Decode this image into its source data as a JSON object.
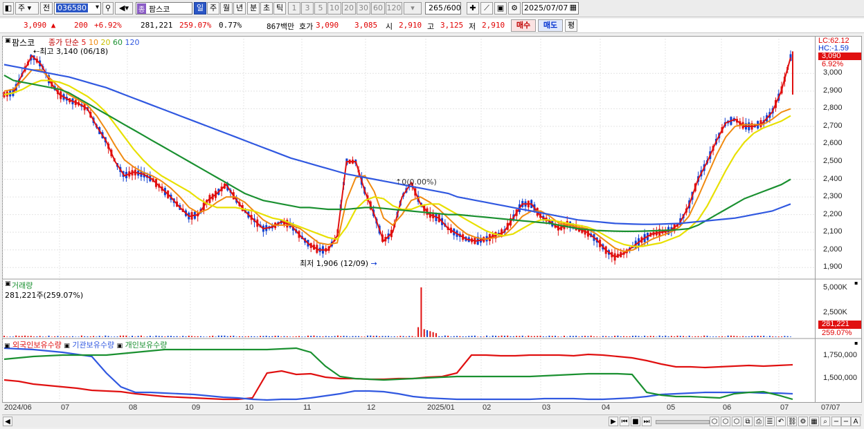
{
  "toolbar": {
    "market": "주",
    "prev_label": "전",
    "code": "036580",
    "stock_name": "팜스코",
    "stock_badge": "종",
    "periods": [
      "일",
      "주",
      "월",
      "년",
      "분",
      "초",
      "틱"
    ],
    "minutes": [
      "1",
      "3",
      "5",
      "10",
      "20",
      "30",
      "60",
      "120"
    ],
    "count": "265",
    "count_total": "/600",
    "date": "2025/07/07"
  },
  "info": {
    "price": "3,090 ▲",
    "change": "200",
    "change_pct": "+6.92%",
    "volume": "281,221",
    "volume_pct": "259.07%",
    "turnover": "0.77%",
    "amount": "867백만",
    "quote_label": "호가",
    "ask": "3,090",
    "bid": "3,085",
    "open_label": "시",
    "open": "2,910",
    "high_label": "고",
    "high": "3,125",
    "low_label": "저",
    "low": "2,910",
    "buy": "매수",
    "sell": "매도",
    "avg": "평"
  },
  "price_panel": {
    "name": "팜스코",
    "legend": "종가 단순 5 10 20 60 120",
    "ma_labels": [
      "5",
      "10",
      "20",
      "60",
      "120"
    ],
    "ma_colors": [
      "#e01010",
      "#f08a10",
      "#e8e000",
      "#1a9030",
      "#3058e0"
    ],
    "high_note": "최고 3,140 (06/18)",
    "low_note": "최저 1,906 (12/09)",
    "mid_note": "0(0.00%)",
    "lc": "LC:62.12",
    "hc": "HC:-1.59",
    "current_price": "3,090",
    "current_pct": "6.92%",
    "yticks": [
      "3,000",
      "2,900",
      "2,800",
      "2,700",
      "2,600",
      "2,500",
      "2,400",
      "2,300",
      "2,200",
      "2,100",
      "2,000",
      "1,900"
    ]
  },
  "volume_panel": {
    "title": "거래량",
    "value": "281,221주(259.07%)",
    "yticks": [
      "5,000K",
      "2,500K"
    ],
    "current": "281,221",
    "current_pct": "259.07%"
  },
  "holdings_panel": {
    "labels": [
      "외국인보유수량",
      "기관보유수량",
      "개인보유수량"
    ],
    "colors": [
      "#e01010",
      "#3058e0",
      "#1a9030"
    ],
    "yticks": [
      "1,750,000",
      "1,500,000"
    ]
  },
  "x_axis": [
    "2024/06",
    "07",
    "08",
    "09",
    "10",
    "11",
    "12",
    "2025/01",
    "02",
    "03",
    "04",
    "05",
    "06",
    "07"
  ],
  "x_right": "07/07",
  "chart_data": {
    "type": "candlestick",
    "period": "daily",
    "ylim": [
      1850,
      3150
    ],
    "series": [
      {
        "name": "5",
        "values": [
          2880,
          2890,
          3000,
          3100,
          3050,
          2950,
          2880,
          2850,
          2830,
          2800,
          2700,
          2620,
          2500,
          2420,
          2440,
          2430,
          2400,
          2350,
          2300,
          2240,
          2190,
          2200,
          2280,
          2320,
          2370,
          2290,
          2220,
          2170,
          2120,
          2130,
          2160,
          2140,
          2080,
          2030,
          2000,
          2000,
          2080,
          2500,
          2500,
          2330,
          2200,
          2050,
          2100,
          2300,
          2380,
          2260,
          2200,
          2180,
          2120,
          2090,
          2060,
          2050,
          2060,
          2080,
          2100,
          2180,
          2260,
          2260,
          2190,
          2160,
          2120,
          2150,
          2120,
          2100,
          2060,
          2000,
          1960,
          1980,
          2020,
          2060,
          2090,
          2100,
          2110,
          2150,
          2250,
          2400,
          2500,
          2620,
          2720,
          2740,
          2700,
          2700,
          2720,
          2780,
          2900,
          3090
        ]
      },
      {
        "name": "10",
        "values": [
          2900,
          2910,
          2960,
          3020,
          3020,
          2970,
          2920,
          2880,
          2850,
          2820,
          2760,
          2680,
          2590,
          2510,
          2470,
          2440,
          2420,
          2390,
          2350,
          2300,
          2240,
          2210,
          2230,
          2270,
          2300,
          2300,
          2270,
          2220,
          2170,
          2140,
          2140,
          2140,
          2120,
          2080,
          2040,
          2030,
          2040,
          2280,
          2410,
          2420,
          2330,
          2180,
          2140,
          2200,
          2280,
          2300,
          2270,
          2230,
          2180,
          2130,
          2090,
          2070,
          2060,
          2070,
          2080,
          2130,
          2190,
          2220,
          2220,
          2190,
          2150,
          2140,
          2130,
          2120,
          2090,
          2050,
          2010,
          1990,
          2000,
          2030,
          2060,
          2080,
          2100,
          2130,
          2190,
          2300,
          2420,
          2540,
          2640,
          2700,
          2710,
          2710,
          2710,
          2740,
          2780,
          2800
        ]
      },
      {
        "name": "20",
        "values": [
          2880,
          2890,
          2910,
          2940,
          2960,
          2960,
          2950,
          2930,
          2900,
          2870,
          2830,
          2780,
          2710,
          2640,
          2570,
          2510,
          2460,
          2420,
          2390,
          2360,
          2330,
          2290,
          2260,
          2240,
          2240,
          2240,
          2230,
          2220,
          2200,
          2180,
          2170,
          2150,
          2130,
          2110,
          2090,
          2070,
          2060,
          2130,
          2230,
          2280,
          2300,
          2290,
          2250,
          2230,
          2230,
          2250,
          2260,
          2260,
          2230,
          2200,
          2170,
          2140,
          2110,
          2090,
          2080,
          2090,
          2120,
          2150,
          2170,
          2170,
          2160,
          2150,
          2140,
          2130,
          2110,
          2080,
          2050,
          2030,
          2020,
          2020,
          2030,
          2040,
          2060,
          2080,
          2120,
          2170,
          2250,
          2350,
          2450,
          2540,
          2610,
          2660,
          2690,
          2710,
          2730,
          2760
        ]
      },
      {
        "name": "60",
        "values": [
          2990,
          2960,
          2950,
          2940,
          2930,
          2920,
          2910,
          2890,
          2860,
          2830,
          2800,
          2770,
          2740,
          2710,
          2680,
          2650,
          2620,
          2590,
          2560,
          2530,
          2500,
          2470,
          2440,
          2410,
          2380,
          2350,
          2320,
          2300,
          2280,
          2270,
          2260,
          2250,
          2240,
          2240,
          2235,
          2230,
          2230,
          2230,
          2235,
          2240,
          2240,
          2235,
          2230,
          2225,
          2220,
          2215,
          2210,
          2205,
          2200,
          2200,
          2195,
          2190,
          2185,
          2180,
          2175,
          2170,
          2165,
          2160,
          2155,
          2150,
          2140,
          2130,
          2120,
          2115,
          2110,
          2108,
          2106,
          2105,
          2105,
          2106,
          2108,
          2110,
          2112,
          2115,
          2120,
          2140,
          2170,
          2200,
          2230,
          2260,
          2290,
          2310,
          2330,
          2350,
          2370,
          2400
        ]
      },
      {
        "name": "120",
        "values": [
          3050,
          3040,
          3030,
          3020,
          3010,
          3000,
          2990,
          2980,
          2965,
          2950,
          2935,
          2920,
          2900,
          2880,
          2860,
          2840,
          2820,
          2800,
          2780,
          2760,
          2740,
          2720,
          2700,
          2680,
          2660,
          2640,
          2620,
          2600,
          2580,
          2560,
          2540,
          2520,
          2505,
          2490,
          2475,
          2460,
          2445,
          2430,
          2420,
          2410,
          2400,
          2390,
          2380,
          2370,
          2360,
          2350,
          2340,
          2330,
          2320,
          2300,
          2290,
          2280,
          2270,
          2260,
          2250,
          2240,
          2230,
          2220,
          2210,
          2200,
          2190,
          2180,
          2170,
          2165,
          2160,
          2155,
          2150,
          2148,
          2146,
          2145,
          2145,
          2146,
          2148,
          2150,
          2155,
          2160,
          2165,
          2170,
          2175,
          2180,
          2190,
          2200,
          2210,
          2220,
          2240,
          2260
        ]
      }
    ],
    "volume_spike": 5000,
    "holdings": {
      "foreign": "red",
      "institution": "blue",
      "individual": "green"
    }
  }
}
